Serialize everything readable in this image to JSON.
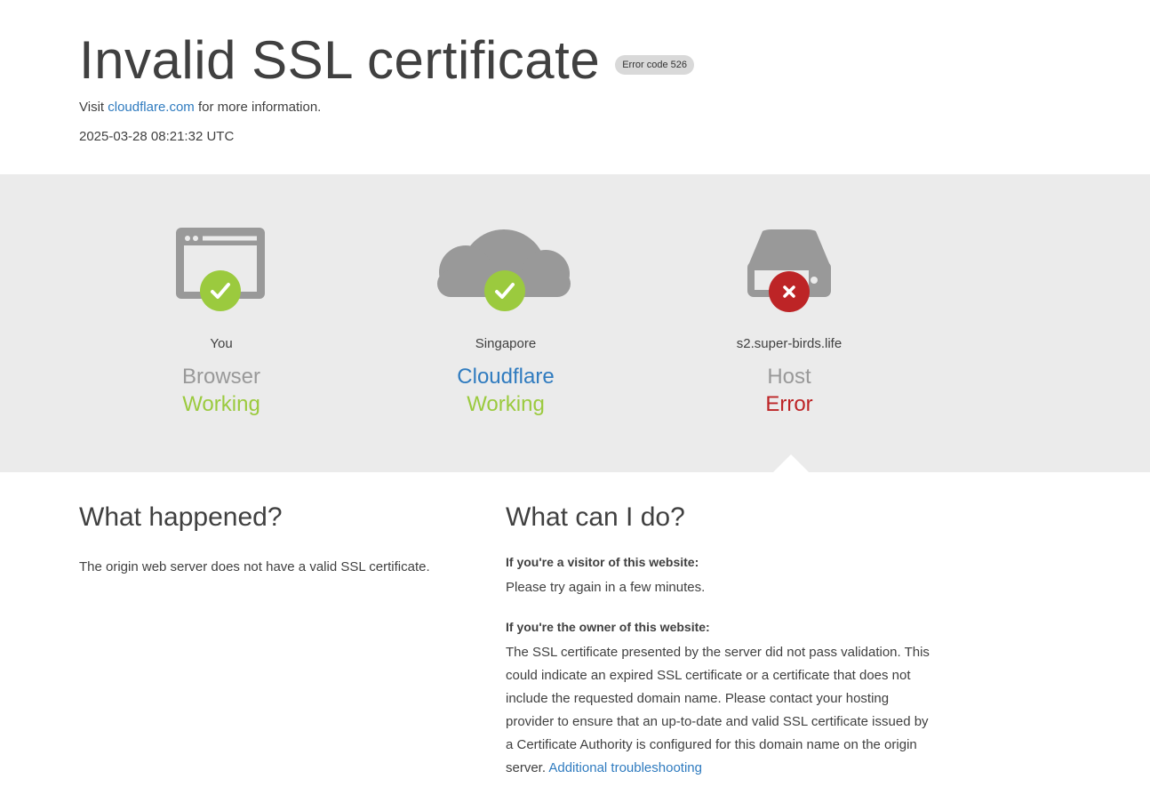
{
  "header": {
    "title": "Invalid SSL certificate",
    "error_code": "Error code 526",
    "visit_prefix": "Visit",
    "visit_link": "cloudflare.com",
    "visit_suffix": "for more information.",
    "timestamp": "2025-03-28 08:21:32 UTC"
  },
  "status": {
    "browser": {
      "location": "You",
      "role": "Browser",
      "state": "Working",
      "icon": "browser-window-icon",
      "badge": "check-icon"
    },
    "cloudflare": {
      "location": "Singapore",
      "role": "Cloudflare",
      "state": "Working",
      "icon": "cloud-icon",
      "badge": "check-icon"
    },
    "host": {
      "location": "s2.super-birds.life",
      "role": "Host",
      "state": "Error",
      "icon": "server-icon",
      "badge": "x-icon"
    }
  },
  "colors": {
    "ok": "#9bca3e",
    "error": "#bd2426",
    "link": "#2f7bbf",
    "band": "#ebebeb",
    "icon_gray": "#999999"
  },
  "what_happened": {
    "heading": "What happened?",
    "text": "The origin web server does not have a valid SSL certificate."
  },
  "what_can_i_do": {
    "heading": "What can I do?",
    "visitor_heading": "If you're a visitor of this website:",
    "visitor_text": "Please try again in a few minutes.",
    "owner_heading": "If you're the owner of this website:",
    "owner_text": "The SSL certificate presented by the server did not pass validation. This could indicate an expired SSL certificate or a certificate that does not include the requested domain name. Please contact your hosting provider to ensure that an up-to-date and valid SSL certificate issued by a Certificate Authority is configured for this domain name on the origin server.",
    "owner_link": "Additional troubleshooting"
  }
}
